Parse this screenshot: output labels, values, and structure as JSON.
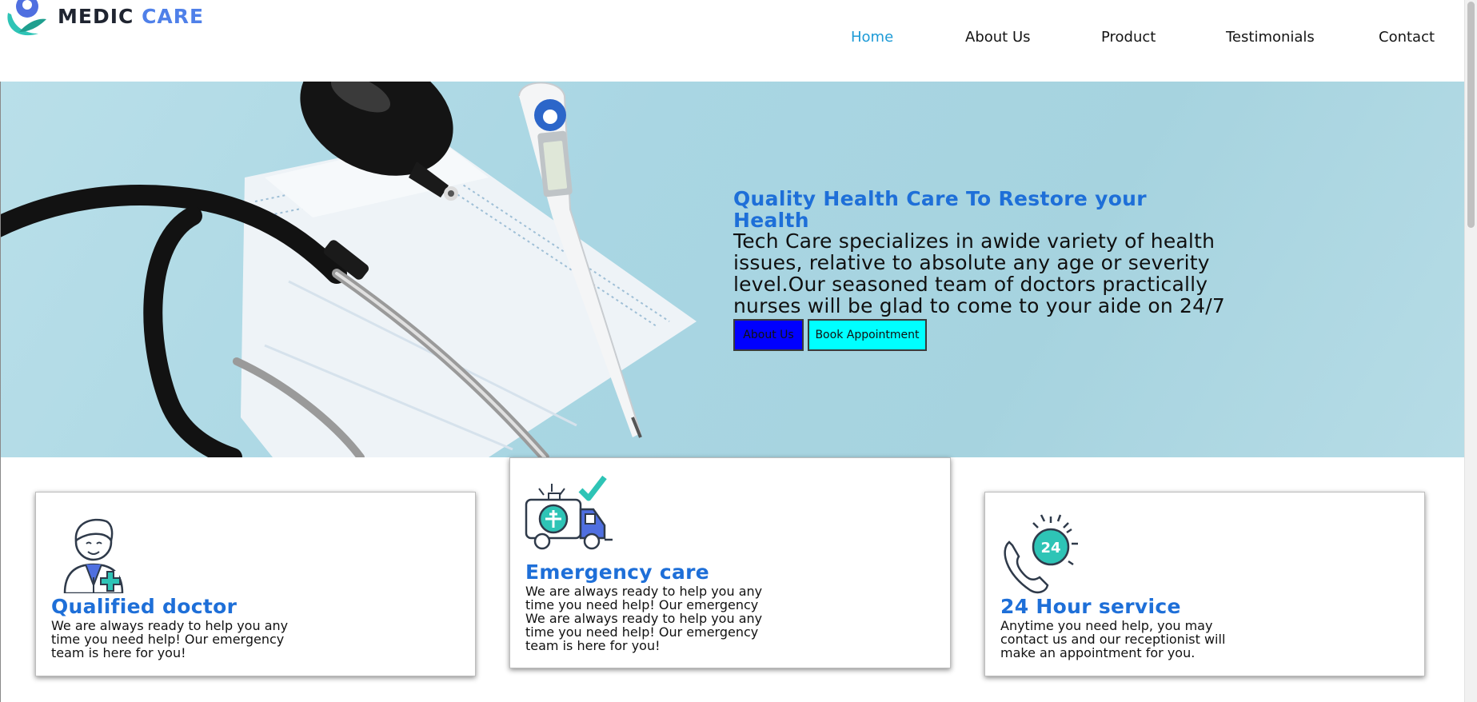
{
  "brand": {
    "part1": "MEDIC",
    "part2": "CARE"
  },
  "nav": [
    {
      "label": "Home",
      "active": true
    },
    {
      "label": "About Us",
      "active": false
    },
    {
      "label": "Product",
      "active": false
    },
    {
      "label": "Testimonials",
      "active": false
    },
    {
      "label": "Contact",
      "active": false
    }
  ],
  "hero": {
    "title": "Quality Health Care To Restore your Health",
    "text": "Tech Care specializes in awide variety of health issues, relative to absolute any age or severity level.Our seasoned team of doctors practically nurses will be glad to come to your aide on 24/7 basis !",
    "btn_about": "About Us",
    "btn_book": "Book Appointment"
  },
  "cards": [
    {
      "icon": "doctor-icon",
      "title": "Qualified doctor",
      "text": "We are always ready to help you any time you need help! Our emergency team is here for you!"
    },
    {
      "icon": "ambulance-icon",
      "title": "Emergency care",
      "text": "We are always ready to help you any time you need help! Our emergency We are always ready to help you any time you need help! Our emergency team is here for you!"
    },
    {
      "icon": "24-hour-phone-icon",
      "title": "24 Hour service",
      "text": "Anytime you need help, you may contact us and our receptionist will make an appointment for you.",
      "badge": "24"
    }
  ],
  "colors": {
    "accent": "#1e6fd8",
    "nav_active": "#1c9ad6",
    "hero_bg": "#a9d6e3",
    "btn_about_bg": "#0000ff",
    "btn_book_bg": "#00ffff",
    "icon_teal": "#2ec4b6",
    "icon_blue": "#4f6fe0"
  }
}
